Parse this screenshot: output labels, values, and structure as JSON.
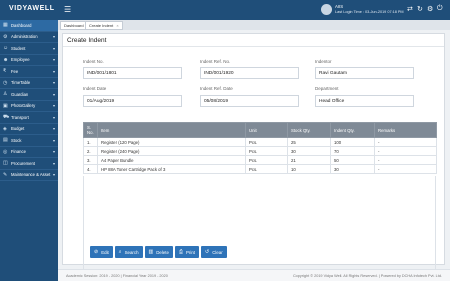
{
  "app": {
    "logo_text": "VIDYAWELL"
  },
  "topbar": {
    "user_name": "AIIS",
    "last_login": "Last Login Time : 03-Jun-2019 07:18 PM",
    "icons": [
      "swap-icon",
      "refresh-icon",
      "settings-icon",
      "power-icon"
    ]
  },
  "sidebar": {
    "items": [
      {
        "label": "Dashboard",
        "icon": "dashboard-icon",
        "has_arrow": false
      },
      {
        "label": "Administration",
        "icon": "admin-icon",
        "has_arrow": true
      },
      {
        "label": "Student",
        "icon": "student-icon",
        "has_arrow": true
      },
      {
        "label": "Employee",
        "icon": "employee-icon",
        "has_arrow": true
      },
      {
        "label": "Fee",
        "icon": "fee-icon",
        "has_arrow": true
      },
      {
        "label": "TimeTable",
        "icon": "timetable-icon",
        "has_arrow": true
      },
      {
        "label": "Guardian",
        "icon": "guardian-icon",
        "has_arrow": true
      },
      {
        "label": "PhotoGallery",
        "icon": "gallery-icon",
        "has_arrow": true
      },
      {
        "label": "Transport",
        "icon": "transport-icon",
        "has_arrow": true
      },
      {
        "label": "Budget",
        "icon": "budget-icon",
        "has_arrow": true
      },
      {
        "label": "Stock",
        "icon": "stock-icon",
        "has_arrow": true
      },
      {
        "label": "Finance",
        "icon": "finance-icon",
        "has_arrow": true
      },
      {
        "label": "Procurement",
        "icon": "procurement-icon",
        "has_arrow": true
      },
      {
        "label": "Maintenance & Asset",
        "icon": "maintenance-icon",
        "has_arrow": true
      }
    ]
  },
  "tabs": {
    "dashboard": "Dashboard",
    "create_indent": "Create Indent"
  },
  "page": {
    "title": "Create Indent"
  },
  "form": {
    "indent_no_label": "Indent No.",
    "indent_no_value": "IND/001/1801",
    "indent_ref_no_label": "Indent Ref. No.",
    "indent_ref_no_value": "IND/001/1920",
    "indentor_label": "Indentor",
    "indentor_value": "Ravi Gautam",
    "indent_date_label": "Indent Date",
    "indent_date_value": "01/Aug/2019",
    "indent_ref_date_label": "Indent Ref. Date",
    "indent_ref_date_value": "05/08/2019",
    "department_label": "Department",
    "department_value": "Head Office"
  },
  "table": {
    "headers": [
      "S. No.",
      "Item",
      "Unit",
      "Stock Qty.",
      "Indent Qty.",
      "Remarks"
    ],
    "rows": [
      [
        "1.",
        "Register (120 Page)",
        "Pcs.",
        "25",
        "100",
        "-"
      ],
      [
        "2.",
        "Register (240 Page)",
        "Pcs.",
        "30",
        "70",
        "-"
      ],
      [
        "3.",
        "A4 Paper Bundle",
        "Pcs.",
        "21",
        "50",
        "-"
      ],
      [
        "4.",
        "HP 88A Toner Cartridge Pack of 3",
        "Pcs.",
        "10",
        "30",
        "-"
      ]
    ]
  },
  "actions": {
    "edit": "Edit",
    "search": "Search",
    "delete": "Delete",
    "print": "Print",
    "clear": "Clear"
  },
  "footer": {
    "left": "Academic Session: 2019 - 2020   |   Financial Year 2019 - 2020",
    "right": "Copyright © 2019 Vidya Well. All Rights Reserved.  |  Powered by DCHA Infotech Pvt. Ltd."
  },
  "colors": {
    "primary": "#1f4e79",
    "button": "#2e73b8",
    "table_header": "#7f8a96"
  }
}
